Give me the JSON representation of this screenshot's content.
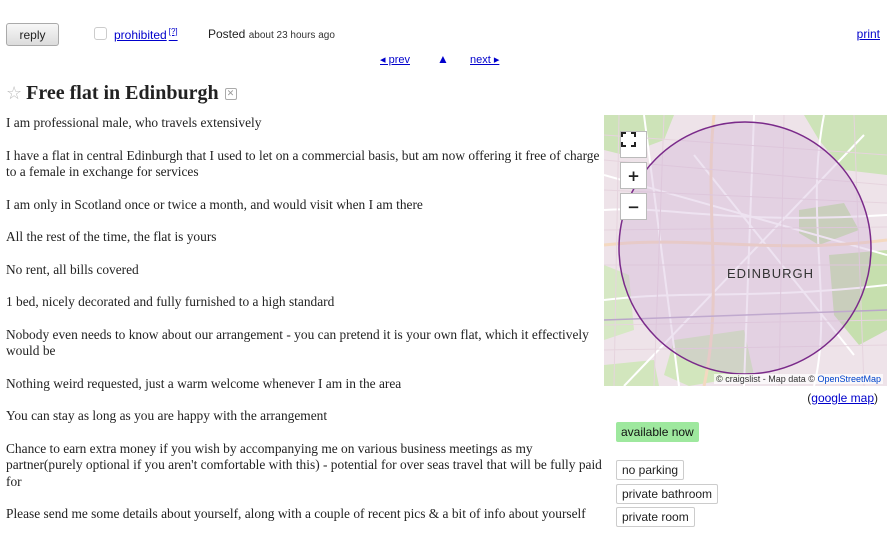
{
  "header": {
    "reply_label": "reply",
    "prohibited_label": "prohibited",
    "prohibited_sup": "[?]",
    "posted_label": "Posted",
    "posted_time": "about 23 hours ago",
    "print_label": "print"
  },
  "nav": {
    "prev_label": "◂ prev",
    "up_symbol": "▲",
    "next_label": "next ▸"
  },
  "posting": {
    "title": "Free flat in Edinburgh",
    "paragraphs": [
      "I am professional male, who travels extensively",
      "I have a flat in central Edinburgh that I used to let on a commercial basis, but am now offering it free of charge to a female in exchange for services",
      "I am only in Scotland once or twice a month, and would visit when I am there",
      "All the rest of the time, the flat is yours",
      "No rent, all bills covered",
      "1 bed, nicely decorated and fully furnished to a high standard",
      "Nobody even needs to know about our arrangement - you can pretend it is your own flat, which it effectively would be",
      "Nothing weird requested, just a warm welcome whenever I am in the area",
      "You can stay as long as you are happy with the arrangement",
      "Chance to earn extra money if you wish by accompanying me on various business meetings as my partner(purely optional if you aren't comfortable with this) - potential for over seas travel that will be fully paid for",
      "Please send me some details about yourself, along with a couple of recent pics & a bit of info about yourself"
    ]
  },
  "map": {
    "city_label": "EDINBURGH",
    "attribution_prefix": "© craigslist - Map data ©",
    "attribution_link": "OpenStreetMap",
    "fullscreen_icon": "fullscreen-icon",
    "zoom_in_label": "+",
    "zoom_out_label": "−",
    "google_map_open": "(",
    "google_map_label": "google map",
    "google_map_close": ")"
  },
  "attributes": {
    "availability": "available now",
    "tags": [
      "no parking",
      "private bathroom",
      "private room"
    ]
  },
  "colors": {
    "link": "#0000cc",
    "available_bg": "#9ee89e",
    "map_circle": "#7a2a8a"
  }
}
